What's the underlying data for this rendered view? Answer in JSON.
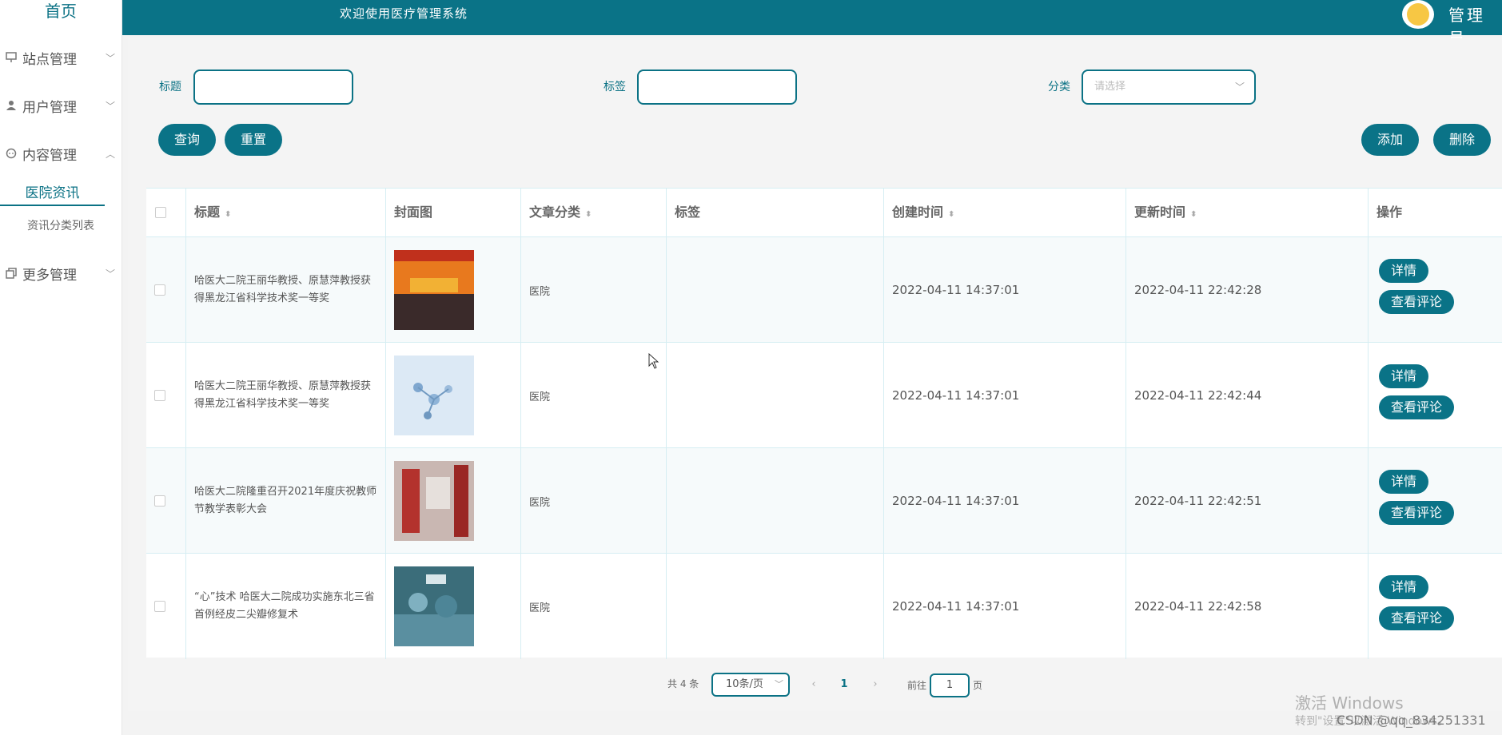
{
  "sidebar": {
    "home": "首页",
    "items": [
      {
        "label": "站点管理",
        "icon": "monitor-icon"
      },
      {
        "label": "用户管理",
        "icon": "user-icon"
      },
      {
        "label": "内容管理",
        "icon": "chat-icon"
      },
      {
        "label": "更多管理",
        "icon": "copy-icon"
      }
    ],
    "active_sub": "医院资讯",
    "sub_item": "资讯分类列表"
  },
  "header": {
    "welcome": "欢迎使用医疗管理系统",
    "user": "管理员"
  },
  "filters": {
    "title_label": "标题",
    "tag_label": "标签",
    "category_label": "分类",
    "category_placeholder": "请选择"
  },
  "buttons": {
    "query": "查询",
    "reset": "重置",
    "add": "添加",
    "delete": "删除"
  },
  "table": {
    "headers": [
      "标题",
      "封面图",
      "文章分类",
      "标签",
      "创建时间",
      "更新时间",
      "操作"
    ],
    "rows": [
      {
        "title": "哈医大二院王丽华教授、原慧萍教授获得黑龙江省科学技术奖一等奖",
        "category": "医院",
        "tag": "",
        "created": "2022-04-11 14:37:01",
        "updated": "2022-04-11 22:42:28"
      },
      {
        "title": "哈医大二院王丽华教授、原慧萍教授获得黑龙江省科学技术奖一等奖",
        "category": "医院",
        "tag": "",
        "created": "2022-04-11 14:37:01",
        "updated": "2022-04-11 22:42:44"
      },
      {
        "title": "哈医大二院隆重召开2021年度庆祝教师节教学表彰大会",
        "category": "医院",
        "tag": "",
        "created": "2022-04-11 14:37:01",
        "updated": "2022-04-11 22:42:51"
      },
      {
        "title": "“心”技术 哈医大二院成功实施东北三省首例经皮二尖瓣修复术",
        "category": "医院",
        "tag": "",
        "created": "2022-04-11 14:37:01",
        "updated": "2022-04-11 22:42:58"
      }
    ],
    "detail_label": "详情",
    "comments_label": "查看评论"
  },
  "pagination": {
    "total": "共 4 条",
    "page_size": "10条/页",
    "current_page": "1",
    "goto_prefix": "前往",
    "goto_value": "1",
    "goto_suffix": "页"
  },
  "watermark": {
    "line1": "激活 Windows",
    "line2": "转到\"设置\"以激活 Windows。",
    "csdn": "CSDN @qq_834251331"
  }
}
